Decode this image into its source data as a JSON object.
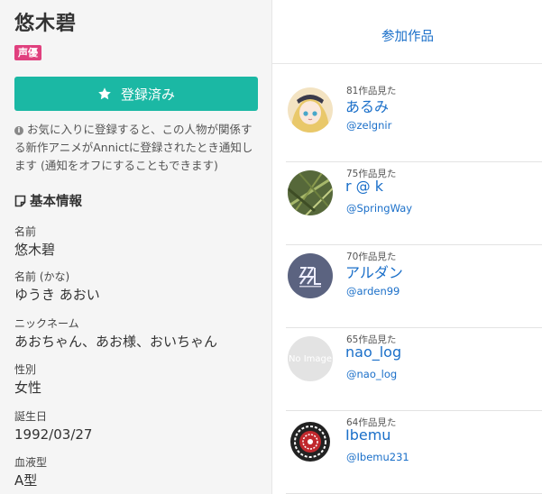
{
  "person": {
    "name": "悠木碧",
    "badge": "声優"
  },
  "favorite_button": {
    "label": "登録済み"
  },
  "note": "お気に入りに登録すると、この人物が関係する新作アニメがAnnictに登録されたとき通知します (通知をオフにすることもできます)",
  "basic_info": {
    "heading": "基本情報",
    "fields": [
      {
        "label": "名前",
        "value": "悠木碧"
      },
      {
        "label": "名前 (かな)",
        "value": "ゆうき あおい"
      },
      {
        "label": "ニックネーム",
        "value": "あおちゃん、あお様、おいちゃん"
      },
      {
        "label": "性別",
        "value": "女性"
      },
      {
        "label": "誕生日",
        "value": "1992/03/27"
      },
      {
        "label": "血液型",
        "value": "A型"
      }
    ]
  },
  "tab": {
    "label": "参加作品"
  },
  "users": [
    {
      "count": "81作品見た",
      "name": "あるみ",
      "handle": "@zelgnir",
      "avatar": "anime-girl-avatar"
    },
    {
      "count": "75作品見た",
      "name": " r @ k",
      "handle": "@SpringWay",
      "avatar": "grass-photo-avatar"
    },
    {
      "count": "70作品見た",
      "name": "アルダン",
      "handle": "@arden99",
      "avatar": "ssl-logo-avatar"
    },
    {
      "count": "65作品見た",
      "name": "nao_log",
      "handle": "@nao_log",
      "avatar": "no-image-avatar",
      "placeholder": "No Image"
    },
    {
      "count": "64作品見た",
      "name": "Ibemu",
      "handle": "@Ibemu231",
      "avatar": "ring-emblem-avatar"
    }
  ],
  "colors": {
    "accent": "#1bb8a4",
    "badge": "#e0407e",
    "link": "#1a6fc9"
  }
}
